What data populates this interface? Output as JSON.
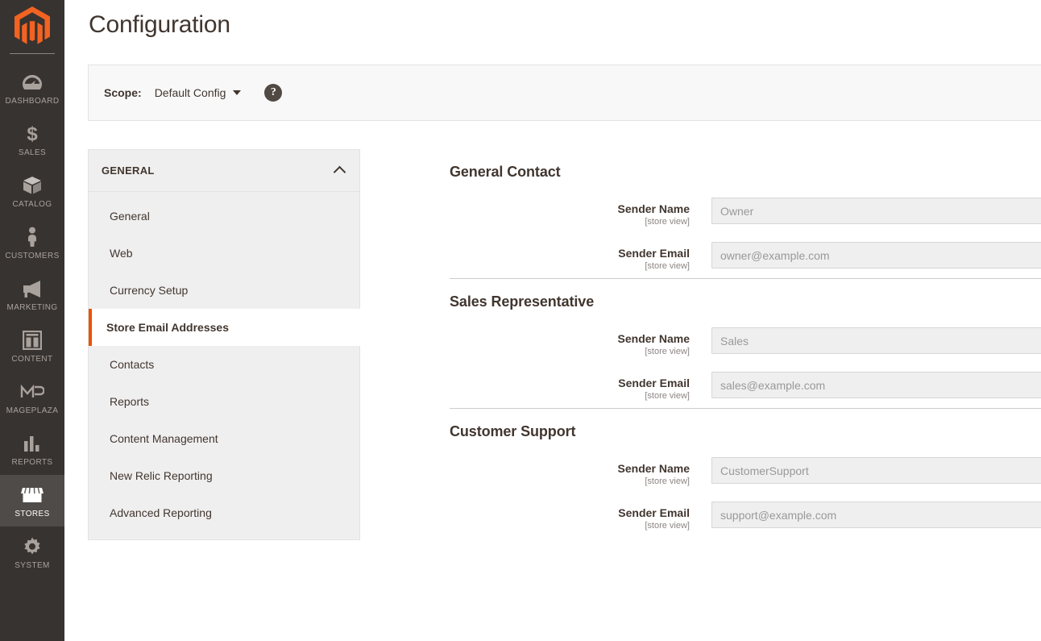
{
  "sidebar": {
    "logo_name": "magento-logo",
    "items": [
      {
        "label": "DASHBOARD",
        "icon": "dashboard-gauge-icon",
        "active": false
      },
      {
        "label": "SALES",
        "icon": "dollar-sign-icon",
        "active": false
      },
      {
        "label": "CATALOG",
        "icon": "box-icon",
        "active": false
      },
      {
        "label": "CUSTOMERS",
        "icon": "person-icon",
        "active": false
      },
      {
        "label": "MARKETING",
        "icon": "megaphone-icon",
        "active": false
      },
      {
        "label": "CONTENT",
        "icon": "layout-panels-icon",
        "active": false
      },
      {
        "label": "MAGEPLAZA",
        "icon": "mageplaza-icon",
        "active": false
      },
      {
        "label": "REPORTS",
        "icon": "bar-chart-icon",
        "active": false
      },
      {
        "label": "STORES",
        "icon": "storefront-icon",
        "active": true
      },
      {
        "label": "SYSTEM",
        "icon": "gear-icon",
        "active": false
      }
    ]
  },
  "header": {
    "title": "Configuration"
  },
  "scope": {
    "label": "Scope:",
    "value": "Default Config",
    "help_glyph": "?"
  },
  "config_nav": {
    "section_title": "GENERAL",
    "items": [
      {
        "label": "General",
        "current": false
      },
      {
        "label": "Web",
        "current": false
      },
      {
        "label": "Currency Setup",
        "current": false
      },
      {
        "label": "Store Email Addresses",
        "current": true
      },
      {
        "label": "Contacts",
        "current": false
      },
      {
        "label": "Reports",
        "current": false
      },
      {
        "label": "Content Management",
        "current": false
      },
      {
        "label": "New Relic Reporting",
        "current": false
      },
      {
        "label": "Advanced Reporting",
        "current": false
      }
    ]
  },
  "form": {
    "scope_note": "[store view]",
    "fieldsets": [
      {
        "legend": "General Contact",
        "fields": [
          {
            "label": "Sender Name",
            "scope": "[store view]",
            "placeholder": "Owner",
            "value": ""
          },
          {
            "label": "Sender Email",
            "scope": "[store view]",
            "placeholder": "owner@example.com",
            "value": ""
          }
        ]
      },
      {
        "legend": "Sales Representative",
        "fields": [
          {
            "label": "Sender Name",
            "scope": "[store view]",
            "placeholder": "Sales",
            "value": ""
          },
          {
            "label": "Sender Email",
            "scope": "[store view]",
            "placeholder": "sales@example.com",
            "value": ""
          }
        ]
      },
      {
        "legend": "Customer Support",
        "fields": [
          {
            "label": "Sender Name",
            "scope": "[store view]",
            "placeholder": "CustomerSupport",
            "value": ""
          },
          {
            "label": "Sender Email",
            "scope": "[store view]",
            "placeholder": "support@example.com",
            "value": ""
          }
        ]
      }
    ]
  },
  "colors": {
    "brand_orange": "#eb5202",
    "logo_orange": "#f26322",
    "sidebar_bg": "#373330",
    "sidebar_active_bg": "#4f4b48",
    "text_dark": "#41362f",
    "panel_bg": "#f0efef",
    "input_bg": "#efefef"
  }
}
